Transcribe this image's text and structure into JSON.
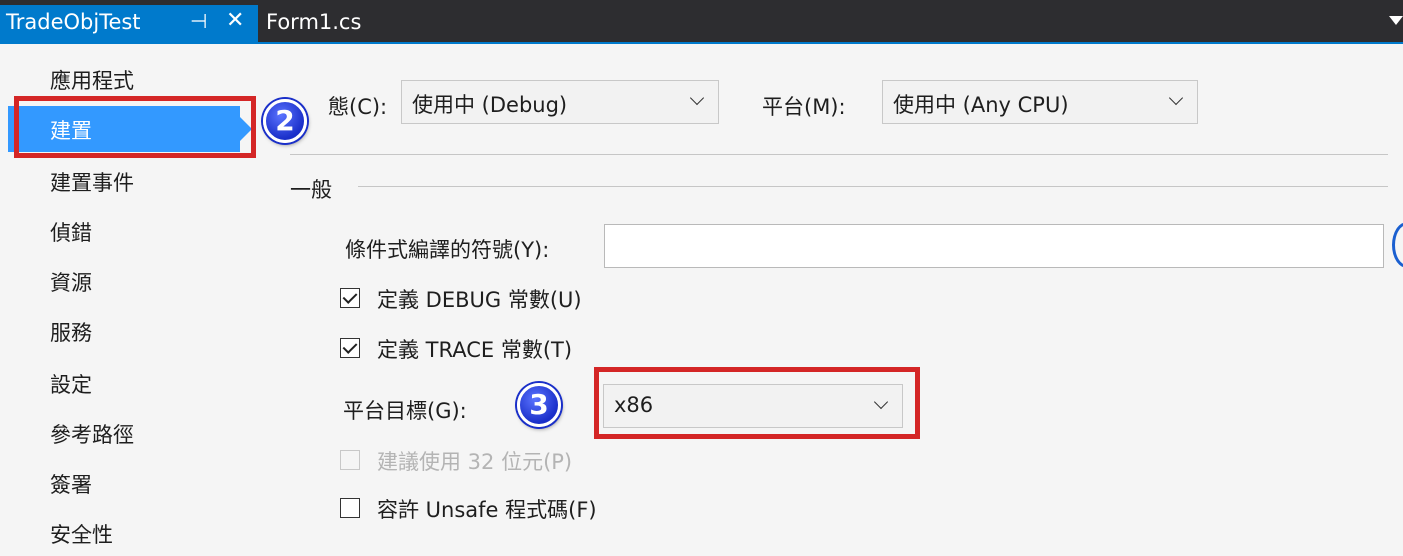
{
  "tabs": {
    "active": {
      "label": "TradeObjTest",
      "pin_glyph": "⊣",
      "close_glyph": "✕"
    },
    "inactive": {
      "label": "Form1.cs"
    }
  },
  "nav": {
    "items": [
      {
        "label": "應用程式"
      },
      {
        "label": "建置"
      },
      {
        "label": "建置事件"
      },
      {
        "label": "偵錯"
      },
      {
        "label": "資源"
      },
      {
        "label": "服務"
      },
      {
        "label": "設定"
      },
      {
        "label": "參考路徑"
      },
      {
        "label": "簽署"
      },
      {
        "label": "安全性"
      }
    ],
    "selected_index": 1
  },
  "badges": {
    "step2": "2",
    "step3": "3"
  },
  "config": {
    "configuration_label": "態(C):",
    "configuration_value": "使用中 (Debug)",
    "platform_label": "平台(M):",
    "platform_value": "使用中 (Any CPU)"
  },
  "general": {
    "section_title": "一般",
    "conditional_symbols_label": "條件式編譯的符號(Y):",
    "conditional_symbols_value": "",
    "define_debug_label": "定義 DEBUG 常數(U)",
    "define_debug_checked": true,
    "define_trace_label": "定義 TRACE 常數(T)",
    "define_trace_checked": true,
    "platform_target_label": "平台目標(G):",
    "platform_target_value": "x86",
    "prefer32_label": "建議使用 32 位元(P)",
    "prefer32_enabled": false,
    "unsafe_label": "容許 Unsafe 程式碼(F)",
    "unsafe_checked": false
  },
  "colors": {
    "accent": "#007acc",
    "selection": "#3399ff",
    "annotation_red": "#d42626",
    "badge_blue": "#1a2fc9"
  }
}
